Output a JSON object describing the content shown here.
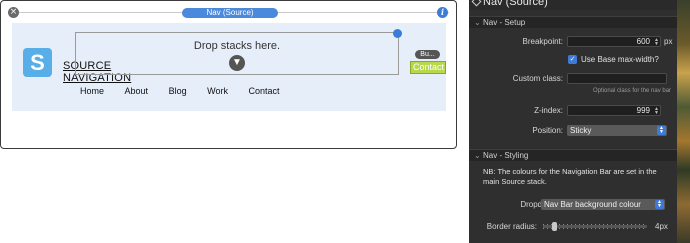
{
  "stack": {
    "title": "Nav (Source)",
    "close_icon": "close-icon",
    "info_icon": "info-icon",
    "logo_letter": "S",
    "brand_line1": "SOURCE",
    "brand_line2": "NAVIGATION",
    "drop_label": "Drop stacks here.",
    "nav_links": [
      "Home",
      "About",
      "Blog",
      "Work",
      "Contact"
    ],
    "side_pill": "Bu...",
    "contact_button": "Contact",
    "colors": {
      "nav_background": "#e6eefa",
      "logo": "#58aee6",
      "contact_button": "#b6d84a",
      "title_pill": "#4a89dc"
    }
  },
  "inspector": {
    "title": "Nav (Source)",
    "setup": {
      "section_label": "Nav - Setup",
      "breakpoint_label": "Breakpoint:",
      "breakpoint_value": "600",
      "breakpoint_unit": "px",
      "base_max_width_label": "Use Base max-width?",
      "base_max_width_checked": true,
      "custom_class_label": "Custom class:",
      "custom_class_value": "",
      "custom_class_hint": "Optional class for the nav bar",
      "zindex_label": "Z-index:",
      "zindex_value": "999",
      "position_label": "Position:",
      "position_value": "Sticky"
    },
    "styling": {
      "section_label": "Nav - Styling",
      "note": "NB: The colours for the Navigation Bar are set in the main Source stack.",
      "dropdowns_label": "Dropdowns:",
      "dropdowns_value": "Nav Bar background colour",
      "border_radius_label": "Border radius:",
      "border_radius_value": "4px"
    }
  }
}
